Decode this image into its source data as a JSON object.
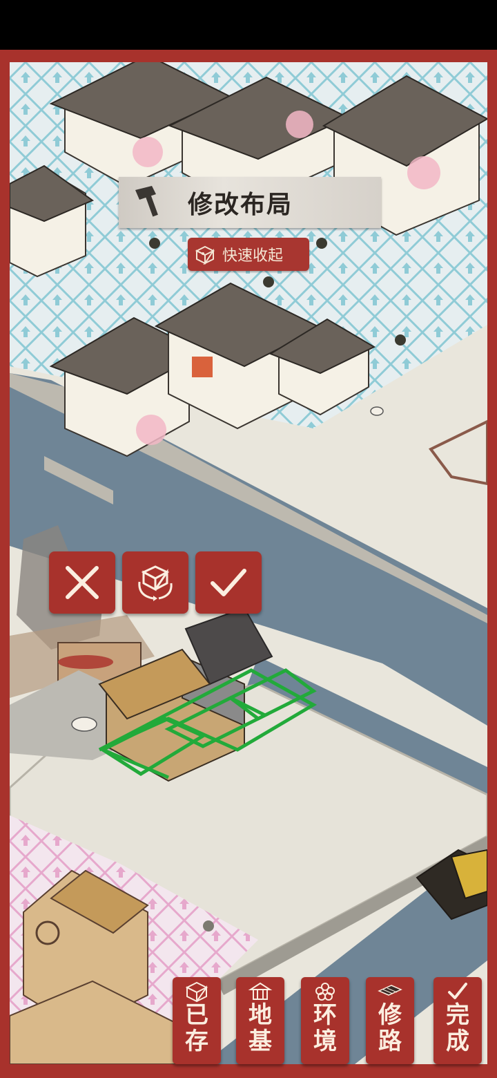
{
  "header": {
    "title": "修改布局",
    "quick_collapse_label": "快速收起"
  },
  "placement_actions": [
    {
      "id": "cancel",
      "icon": "close-icon"
    },
    {
      "id": "rotate",
      "icon": "rotate-icon"
    },
    {
      "id": "confirm",
      "icon": "check-icon"
    }
  ],
  "toolbar": {
    "saved": {
      "label": "已存",
      "icon": "storage-box-icon"
    },
    "foundation": {
      "label": "地基",
      "icon": "pavilion-icon"
    },
    "environment": {
      "label": "环境",
      "icon": "flower-icon"
    },
    "road": {
      "label": "修路",
      "icon": "road-tile-icon"
    },
    "done": {
      "label": "完成",
      "icon": "check-icon"
    }
  },
  "colors": {
    "frame": "#a8322c",
    "button": "#a8322c",
    "water": "#6f8596",
    "ground": "#e9e6dc",
    "placement_outline": "#22aa3a"
  }
}
